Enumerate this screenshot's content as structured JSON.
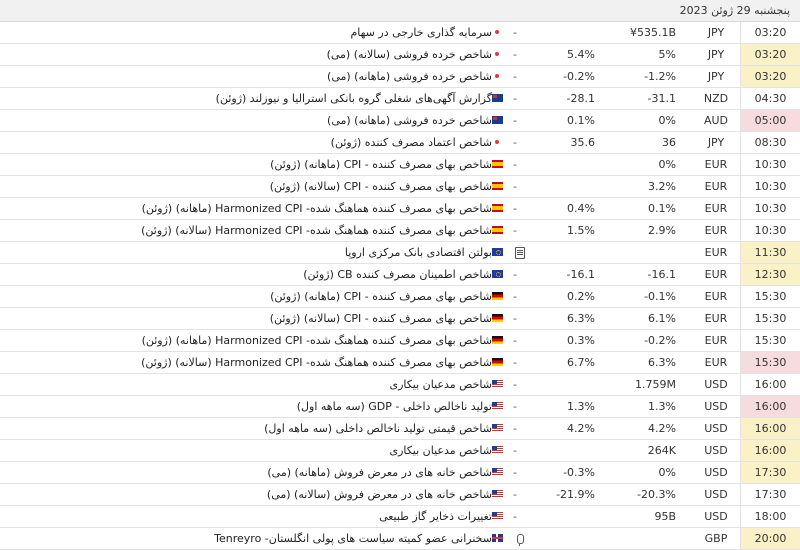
{
  "header": {
    "date": "پنجشنبه 29 ژوئن 2023"
  },
  "rows": [
    {
      "time": "03:20",
      "hl": "",
      "cur": "JPY",
      "actual": "¥535.1B",
      "forecast": "",
      "previous": "-",
      "flag": "dot",
      "event": "سرمایه گذاری خارجی در سهام"
    },
    {
      "time": "03:20",
      "hl": "yellow",
      "cur": "JPY",
      "actual": "5%",
      "forecast": "5.4%",
      "previous": "-",
      "flag": "dot",
      "event": "شاخص خرده فروشی (سالانه) (می)"
    },
    {
      "time": "03:20",
      "hl": "yellow",
      "cur": "JPY",
      "actual": "-1.2%",
      "forecast": "-0.2%",
      "previous": "-",
      "flag": "dot",
      "event": "شاخص خرده فروشی (ماهانه) (می)"
    },
    {
      "time": "04:30",
      "hl": "",
      "cur": "NZD",
      "actual": "-31.1",
      "forecast": "-28.1",
      "previous": "-",
      "flag": "au",
      "event": "گزارش آگهی‌های شغلی گروه بانکی استرالیا و نیوزلند (ژوئن)"
    },
    {
      "time": "05:00",
      "hl": "red",
      "cur": "AUD",
      "actual": "0%",
      "forecast": "0.1%",
      "previous": "-",
      "flag": "au",
      "event": "شاخص خرده فروشی (ماهانه) (می)"
    },
    {
      "time": "08:30",
      "hl": "",
      "cur": "JPY",
      "actual": "36",
      "forecast": "35.6",
      "previous": "-",
      "flag": "dot",
      "event": "شاخص اعتماد مصرف کننده (ژوئن)"
    },
    {
      "time": "10:30",
      "hl": "",
      "cur": "EUR",
      "actual": "0%",
      "forecast": "",
      "previous": "-",
      "flag": "es",
      "event": "شاخص بهای مصرف کننده - CPI (ماهانه) (ژوئن)"
    },
    {
      "time": "10:30",
      "hl": "",
      "cur": "EUR",
      "actual": "3.2%",
      "forecast": "",
      "previous": "-",
      "flag": "es",
      "event": "شاخص بهای مصرف کننده - CPI (سالانه) (ژوئن)"
    },
    {
      "time": "10:30",
      "hl": "",
      "cur": "EUR",
      "actual": "0.1%",
      "forecast": "0.4%",
      "previous": "-",
      "flag": "es",
      "event": "شاخص بهای مصرف کننده هماهنگ شده- Harmonized CPI (ماهانه) (ژوئن)"
    },
    {
      "time": "10:30",
      "hl": "",
      "cur": "EUR",
      "actual": "2.9%",
      "forecast": "1.5%",
      "previous": "-",
      "flag": "es",
      "event": "شاخص بهای مصرف کننده هماهنگ شده- Harmonized CPI (سالانه) (ژوئن)"
    },
    {
      "time": "11:30",
      "hl": "yellow",
      "cur": "EUR",
      "actual": "",
      "forecast": "",
      "previous": "",
      "flag": "eu",
      "icon": "doc",
      "event": "بولتن اقتصادی بانک مرکزی اروپا"
    },
    {
      "time": "12:30",
      "hl": "yellow",
      "cur": "EUR",
      "actual": "-16.1",
      "forecast": "-16.1",
      "previous": "-",
      "flag": "eu",
      "event": "شاخص اطمینان مصرف کننده CB (ژوئن)"
    },
    {
      "time": "15:30",
      "hl": "",
      "cur": "EUR",
      "actual": "-0.1%",
      "forecast": "0.2%",
      "previous": "-",
      "flag": "de",
      "event": "شاخص بهای مصرف کننده - CPI (ماهانه) (ژوئن)"
    },
    {
      "time": "15:30",
      "hl": "",
      "cur": "EUR",
      "actual": "6.1%",
      "forecast": "6.3%",
      "previous": "-",
      "flag": "de",
      "event": "شاخص بهای مصرف کننده - CPI (سالانه) (ژوئن)"
    },
    {
      "time": "15:30",
      "hl": "",
      "cur": "EUR",
      "actual": "-0.2%",
      "forecast": "0.3%",
      "previous": "-",
      "flag": "de",
      "event": "شاخص بهای مصرف کننده هماهنگ شده- Harmonized CPI (ماهانه) (ژوئن)"
    },
    {
      "time": "15:30",
      "hl": "red",
      "cur": "EUR",
      "actual": "6.3%",
      "forecast": "6.7%",
      "previous": "-",
      "flag": "de",
      "event": "شاخص بهای مصرف کننده هماهنگ شده- Harmonized CPI (سالانه) (ژوئن)"
    },
    {
      "time": "16:00",
      "hl": "",
      "cur": "USD",
      "actual": "1.759M",
      "forecast": "",
      "previous": "-",
      "flag": "us",
      "event": "شاخص مدعیان بیکاری"
    },
    {
      "time": "16:00",
      "hl": "red",
      "cur": "USD",
      "actual": "1.3%",
      "forecast": "1.3%",
      "previous": "-",
      "flag": "us",
      "event": "تولید ناخالص داخلی - GDP (سه ماهه اول)"
    },
    {
      "time": "16:00",
      "hl": "yellow",
      "cur": "USD",
      "actual": "4.2%",
      "forecast": "4.2%",
      "previous": "-",
      "flag": "us",
      "event": "شاخص قیمتی تولید ناخالص داخلی (سه ماهه اول)"
    },
    {
      "time": "16:00",
      "hl": "yellow",
      "cur": "USD",
      "actual": "264K",
      "forecast": "",
      "previous": "-",
      "flag": "us",
      "event": "شاخص مدعیان بیکاری"
    },
    {
      "time": "17:30",
      "hl": "yellow",
      "cur": "USD",
      "actual": "0%",
      "forecast": "-0.3%",
      "previous": "-",
      "flag": "us",
      "event": "شاخص خانه های در معرض فروش (ماهانه) (می)"
    },
    {
      "time": "17:30",
      "hl": "",
      "cur": "USD",
      "actual": "-20.3%",
      "forecast": "-21.9%",
      "previous": "-",
      "flag": "us",
      "event": "شاخص خانه های در معرض فروش (سالانه) (می)"
    },
    {
      "time": "18:00",
      "hl": "",
      "cur": "USD",
      "actual": "95B",
      "forecast": "",
      "previous": "-",
      "flag": "us",
      "event": "تغییرات ذخایر گاز طبیعی"
    },
    {
      "time": "20:00",
      "hl": "yellow",
      "cur": "GBP",
      "actual": "",
      "forecast": "",
      "previous": "",
      "flag": "gb",
      "icon": "mic",
      "event": "سخنرانی عضو کمیته سیاست های پولی انگلستان- Tenreyro"
    }
  ]
}
